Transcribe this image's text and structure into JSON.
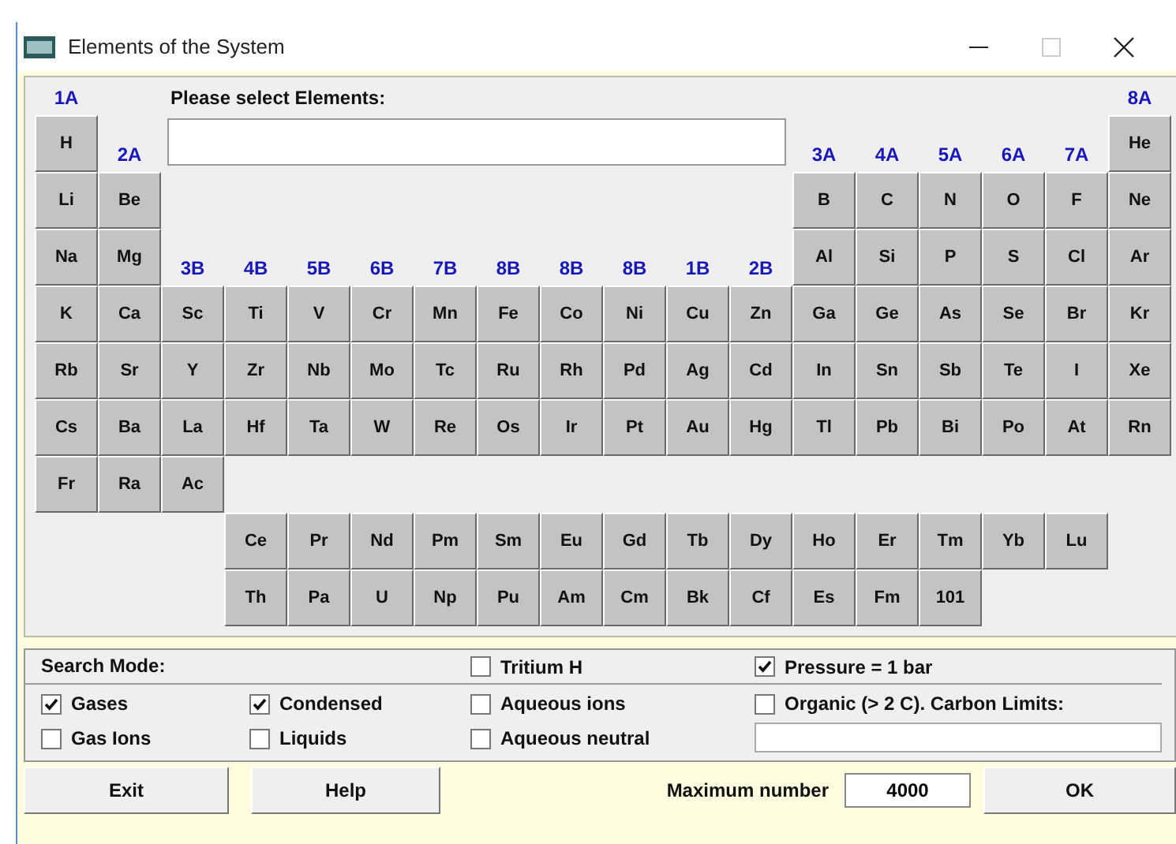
{
  "window": {
    "title": "Elements of the System"
  },
  "table": {
    "rows": [
      {
        "cells": [
          {
            "kind": "label",
            "text": "1A"
          },
          {
            "kind": "gap"
          },
          {
            "kind": "prompt",
            "text": "Please select Elements:"
          },
          {
            "kind": "gap"
          },
          {
            "kind": "gap"
          },
          {
            "kind": "gap"
          },
          {
            "kind": "gap"
          },
          {
            "kind": "gap"
          },
          {
            "kind": "gap"
          },
          {
            "kind": "gap"
          },
          {
            "kind": "gap"
          },
          {
            "kind": "gap"
          },
          {
            "kind": "gap"
          },
          {
            "kind": "gap"
          },
          {
            "kind": "gap"
          },
          {
            "kind": "gap"
          },
          {
            "kind": "gap"
          },
          {
            "kind": "label",
            "text": "8A"
          }
        ]
      },
      {
        "cells": [
          {
            "kind": "element",
            "text": "H"
          },
          {
            "kind": "label",
            "text": "2A"
          },
          {
            "kind": "input"
          },
          {
            "kind": "gap"
          },
          {
            "kind": "gap"
          },
          {
            "kind": "gap"
          },
          {
            "kind": "gap"
          },
          {
            "kind": "gap"
          },
          {
            "kind": "gap"
          },
          {
            "kind": "gap"
          },
          {
            "kind": "gap"
          },
          {
            "kind": "gap"
          },
          {
            "kind": "label",
            "text": "3A"
          },
          {
            "kind": "label",
            "text": "4A"
          },
          {
            "kind": "label",
            "text": "5A"
          },
          {
            "kind": "label",
            "text": "6A"
          },
          {
            "kind": "label",
            "text": "7A"
          },
          {
            "kind": "element",
            "text": "He"
          }
        ]
      },
      {
        "cells": [
          {
            "kind": "element",
            "text": "Li"
          },
          {
            "kind": "element",
            "text": "Be"
          },
          {
            "kind": "gap"
          },
          {
            "kind": "gap"
          },
          {
            "kind": "gap"
          },
          {
            "kind": "gap"
          },
          {
            "kind": "gap"
          },
          {
            "kind": "gap"
          },
          {
            "kind": "gap"
          },
          {
            "kind": "gap"
          },
          {
            "kind": "gap"
          },
          {
            "kind": "gap"
          },
          {
            "kind": "element",
            "text": "B"
          },
          {
            "kind": "element",
            "text": "C"
          },
          {
            "kind": "element",
            "text": "N"
          },
          {
            "kind": "element",
            "text": "O"
          },
          {
            "kind": "element",
            "text": "F"
          },
          {
            "kind": "element",
            "text": "Ne"
          }
        ]
      },
      {
        "cells": [
          {
            "kind": "element",
            "text": "Na"
          },
          {
            "kind": "element",
            "text": "Mg"
          },
          {
            "kind": "label",
            "text": "3B"
          },
          {
            "kind": "label",
            "text": "4B"
          },
          {
            "kind": "label",
            "text": "5B"
          },
          {
            "kind": "label",
            "text": "6B"
          },
          {
            "kind": "label",
            "text": "7B"
          },
          {
            "kind": "label",
            "text": "8B"
          },
          {
            "kind": "label",
            "text": "8B"
          },
          {
            "kind": "label",
            "text": "8B"
          },
          {
            "kind": "label",
            "text": "1B"
          },
          {
            "kind": "label",
            "text": "2B"
          },
          {
            "kind": "element",
            "text": "Al"
          },
          {
            "kind": "element",
            "text": "Si"
          },
          {
            "kind": "element",
            "text": "P"
          },
          {
            "kind": "element",
            "text": "S"
          },
          {
            "kind": "element",
            "text": "Cl"
          },
          {
            "kind": "element",
            "text": "Ar"
          }
        ]
      },
      {
        "cells": [
          {
            "kind": "element",
            "text": "K"
          },
          {
            "kind": "element",
            "text": "Ca"
          },
          {
            "kind": "element",
            "text": "Sc"
          },
          {
            "kind": "element",
            "text": "Ti"
          },
          {
            "kind": "element",
            "text": "V"
          },
          {
            "kind": "element",
            "text": "Cr"
          },
          {
            "kind": "element",
            "text": "Mn"
          },
          {
            "kind": "element",
            "text": "Fe"
          },
          {
            "kind": "element",
            "text": "Co"
          },
          {
            "kind": "element",
            "text": "Ni"
          },
          {
            "kind": "element",
            "text": "Cu"
          },
          {
            "kind": "element",
            "text": "Zn"
          },
          {
            "kind": "element",
            "text": "Ga"
          },
          {
            "kind": "element",
            "text": "Ge"
          },
          {
            "kind": "element",
            "text": "As"
          },
          {
            "kind": "element",
            "text": "Se"
          },
          {
            "kind": "element",
            "text": "Br"
          },
          {
            "kind": "element",
            "text": "Kr"
          }
        ]
      },
      {
        "cells": [
          {
            "kind": "element",
            "text": "Rb"
          },
          {
            "kind": "element",
            "text": "Sr"
          },
          {
            "kind": "element",
            "text": "Y"
          },
          {
            "kind": "element",
            "text": "Zr"
          },
          {
            "kind": "element",
            "text": "Nb"
          },
          {
            "kind": "element",
            "text": "Mo"
          },
          {
            "kind": "element",
            "text": "Tc"
          },
          {
            "kind": "element",
            "text": "Ru"
          },
          {
            "kind": "element",
            "text": "Rh"
          },
          {
            "kind": "element",
            "text": "Pd"
          },
          {
            "kind": "element",
            "text": "Ag"
          },
          {
            "kind": "element",
            "text": "Cd"
          },
          {
            "kind": "element",
            "text": "In"
          },
          {
            "kind": "element",
            "text": "Sn"
          },
          {
            "kind": "element",
            "text": "Sb"
          },
          {
            "kind": "element",
            "text": "Te"
          },
          {
            "kind": "element",
            "text": "I"
          },
          {
            "kind": "element",
            "text": "Xe"
          }
        ]
      },
      {
        "cells": [
          {
            "kind": "element",
            "text": "Cs"
          },
          {
            "kind": "element",
            "text": "Ba"
          },
          {
            "kind": "element",
            "text": "La"
          },
          {
            "kind": "element",
            "text": "Hf"
          },
          {
            "kind": "element",
            "text": "Ta"
          },
          {
            "kind": "element",
            "text": "W"
          },
          {
            "kind": "element",
            "text": "Re"
          },
          {
            "kind": "element",
            "text": "Os"
          },
          {
            "kind": "element",
            "text": "Ir"
          },
          {
            "kind": "element",
            "text": "Pt"
          },
          {
            "kind": "element",
            "text": "Au"
          },
          {
            "kind": "element",
            "text": "Hg"
          },
          {
            "kind": "element",
            "text": "Tl"
          },
          {
            "kind": "element",
            "text": "Pb"
          },
          {
            "kind": "element",
            "text": "Bi"
          },
          {
            "kind": "element",
            "text": "Po"
          },
          {
            "kind": "element",
            "text": "At"
          },
          {
            "kind": "element",
            "text": "Rn"
          }
        ]
      },
      {
        "cells": [
          {
            "kind": "element",
            "text": "Fr"
          },
          {
            "kind": "element",
            "text": "Ra"
          },
          {
            "kind": "element",
            "text": "Ac"
          }
        ]
      },
      {
        "cells": [
          {
            "kind": "gap"
          },
          {
            "kind": "gap"
          },
          {
            "kind": "gap"
          },
          {
            "kind": "element",
            "text": "Ce"
          },
          {
            "kind": "element",
            "text": "Pr"
          },
          {
            "kind": "element",
            "text": "Nd"
          },
          {
            "kind": "element",
            "text": "Pm"
          },
          {
            "kind": "element",
            "text": "Sm"
          },
          {
            "kind": "element",
            "text": "Eu"
          },
          {
            "kind": "element",
            "text": "Gd"
          },
          {
            "kind": "element",
            "text": "Tb"
          },
          {
            "kind": "element",
            "text": "Dy"
          },
          {
            "kind": "element",
            "text": "Ho"
          },
          {
            "kind": "element",
            "text": "Er"
          },
          {
            "kind": "element",
            "text": "Tm"
          },
          {
            "kind": "element",
            "text": "Yb"
          },
          {
            "kind": "element",
            "text": "Lu"
          }
        ]
      },
      {
        "cells": [
          {
            "kind": "gap"
          },
          {
            "kind": "gap"
          },
          {
            "kind": "gap"
          },
          {
            "kind": "element",
            "text": "Th"
          },
          {
            "kind": "element",
            "text": "Pa"
          },
          {
            "kind": "element",
            "text": "U"
          },
          {
            "kind": "element",
            "text": "Np"
          },
          {
            "kind": "element",
            "text": "Pu"
          },
          {
            "kind": "element",
            "text": "Am"
          },
          {
            "kind": "element",
            "text": "Cm"
          },
          {
            "kind": "element",
            "text": "Bk"
          },
          {
            "kind": "element",
            "text": "Cf"
          },
          {
            "kind": "element",
            "text": "Es"
          },
          {
            "kind": "element",
            "text": "Fm"
          },
          {
            "kind": "element",
            "text": "101"
          }
        ]
      }
    ]
  },
  "search_mode": {
    "items": [
      {
        "kind": "heading",
        "text": "Search Mode:"
      },
      {
        "kind": "checkbox",
        "label": "Tritium H",
        "checked": false
      },
      {
        "kind": "checkbox",
        "label": "Pressure = 1 bar",
        "checked": true
      },
      {
        "kind": "checkbox",
        "label": "Gases",
        "checked": true
      },
      {
        "kind": "checkbox",
        "label": "Condensed",
        "checked": true
      },
      {
        "kind": "checkbox",
        "label": "Aqueous ions",
        "checked": false
      },
      {
        "kind": "checkbox",
        "label": "Organic (> 2 C). Carbon Limits:",
        "checked": false
      },
      {
        "kind": "checkbox",
        "label": "Gas Ions",
        "checked": false
      },
      {
        "kind": "checkbox",
        "label": "Liquids",
        "checked": false
      },
      {
        "kind": "checkbox",
        "label": "Aqueous neutral",
        "checked": false
      },
      {
        "kind": "field"
      }
    ]
  },
  "footer": {
    "exit": "Exit",
    "help": "Help",
    "max_label": "Maximum number",
    "max_value": "4000",
    "ok": "OK"
  }
}
